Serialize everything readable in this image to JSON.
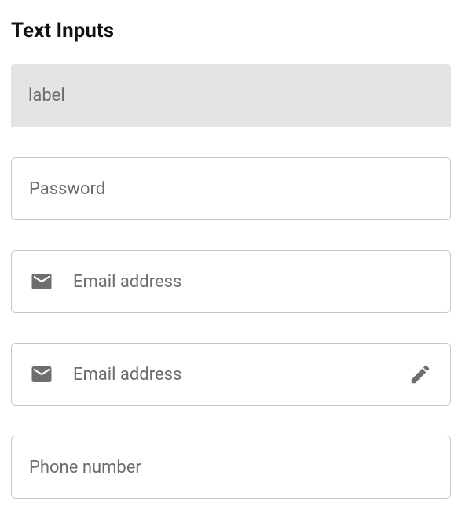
{
  "heading": "Text Inputs",
  "fields": {
    "filled_label": "label",
    "password_placeholder": "Password",
    "email1_placeholder": "Email address",
    "email2_placeholder": "Email address",
    "phone_placeholder": "Phone number"
  }
}
